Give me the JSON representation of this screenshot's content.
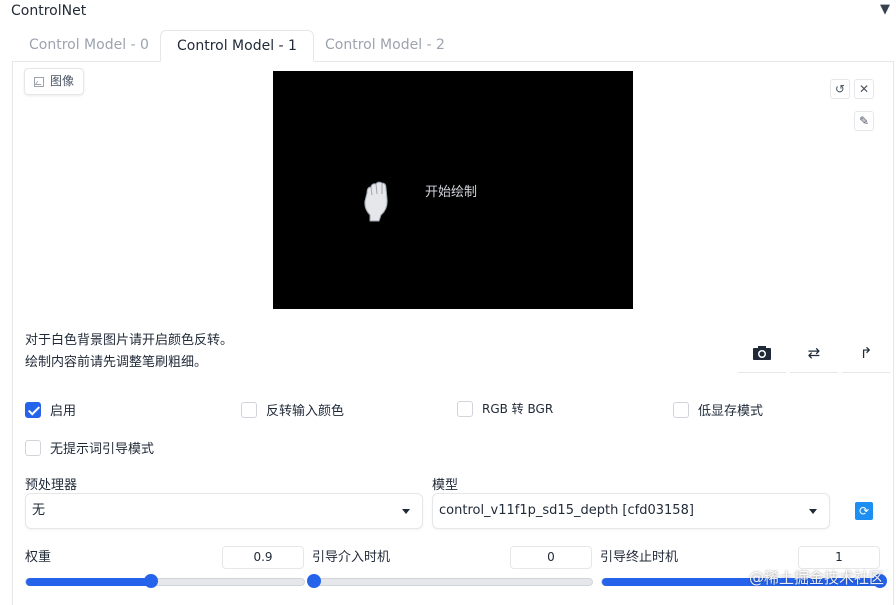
{
  "header": {
    "title": "ControlNet",
    "collapse_icon": "▼"
  },
  "tabs": [
    {
      "label": "Control Model - 0"
    },
    {
      "label": "Control Model - 1"
    },
    {
      "label": "Control Model - 2"
    }
  ],
  "image_panel": {
    "label": "图像",
    "canvas_text": "开始绘制",
    "undo_icon": "↺",
    "clear_icon": "✕",
    "brush_icon": "✎"
  },
  "hints": [
    "对于白色背景图片请开启颜色反转。",
    "绘制内容前请先调整笔刷粗细。"
  ],
  "actions": {
    "camera_icon": "📷",
    "swap_icon": "⇄",
    "send_icon": "↱"
  },
  "checkboxes": {
    "enable": {
      "label": "启用",
      "checked": true
    },
    "invert": {
      "label": "反转输入颜色",
      "checked": false
    },
    "rgb_bgr": {
      "label": "RGB 转 BGR",
      "checked": false
    },
    "lowvram": {
      "label": "低显存模式",
      "checked": false
    },
    "guess": {
      "label": "无提示词引导模式",
      "checked": false
    }
  },
  "preprocessor": {
    "label": "预处理器",
    "value": "无"
  },
  "model": {
    "label": "模型",
    "value": "control_v11f1p_sd15_depth [cfd03158]",
    "refresh_icon": "⟳"
  },
  "weight": {
    "label": "权重",
    "value": "0.9",
    "fraction": 0.45
  },
  "guidance_start": {
    "label": "引导介入时机",
    "value": "0",
    "fraction": 0.0
  },
  "guidance_end": {
    "label": "引导终止时机",
    "value": "1",
    "fraction": 1.0
  },
  "watermark": "@稀土掘金技术社区"
}
